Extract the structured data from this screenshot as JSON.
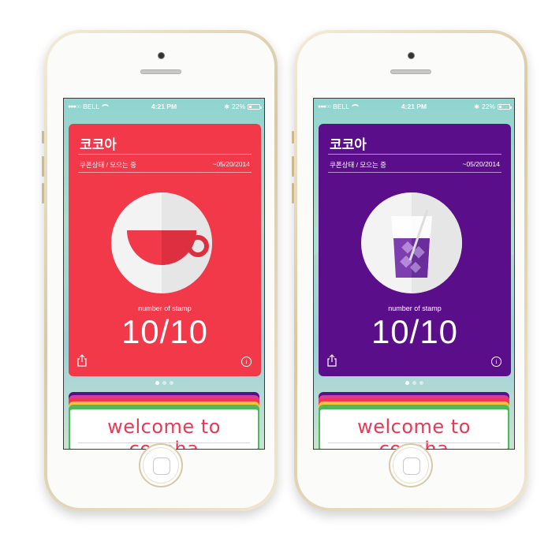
{
  "colors": {
    "card_red": "#f2394a",
    "card_purple": "#5b0e8a",
    "welcome_text": "#e83a55"
  },
  "phones": [
    {
      "status": {
        "carrier": "BELL",
        "time": "4:21 PM",
        "battery": "22%"
      },
      "card": {
        "title": "코코아",
        "status": "쿠폰상태 / 모으는 중",
        "date": "~05/20/2014",
        "stamp_label": "number of stamp",
        "stamp_count": "10/10",
        "icon": "coffee-cup-icon"
      },
      "page_dots": {
        "count": 3,
        "active": 0
      },
      "welcome": "welcome to cocoha"
    },
    {
      "status": {
        "carrier": "BELL",
        "time": "4:21 PM",
        "battery": "22%"
      },
      "card": {
        "title": "코코아",
        "status": "쿠폰상태 / 모으는 중",
        "date": "~05/20/2014",
        "stamp_label": "number of stamp",
        "stamp_count": "10/10",
        "icon": "iced-drink-icon"
      },
      "page_dots": {
        "count": 3,
        "active": 0
      },
      "welcome": "welcome to cocoha"
    }
  ]
}
